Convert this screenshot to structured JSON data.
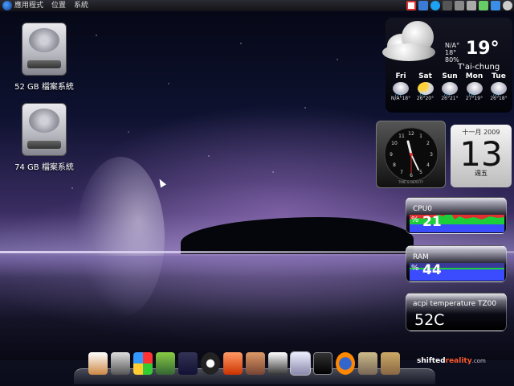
{
  "top_panel": {
    "menu": [
      "應用程式",
      "位置",
      "系統"
    ],
    "tray_icons": [
      "gmail-icon",
      "user-icon",
      "skype-icon",
      "bluetooth-icon",
      "volume-icon",
      "network-icon",
      "battery-icon",
      "update-icon",
      "power-icon"
    ]
  },
  "desktop": {
    "drives": [
      {
        "label": "52 GB 檔案系統",
        "icon": "hard-drive-icon"
      },
      {
        "label": "74 GB 檔案系統",
        "icon": "hard-drive-icon"
      }
    ]
  },
  "weather": {
    "condition": "N/A°",
    "hi": "18°",
    "humidity": "80%",
    "temperature": "19°",
    "city": "T'ai-chung",
    "forecast": [
      {
        "day": "Fri",
        "temps": "N/A°18°",
        "icon": "rain-cloud-icon"
      },
      {
        "day": "Sat",
        "temps": "26°20°",
        "icon": "sun-cloud-icon"
      },
      {
        "day": "Sun",
        "temps": "26°21°",
        "icon": "rain-cloud-icon"
      },
      {
        "day": "Mon",
        "temps": "27°19°",
        "icon": "rain-cloud-icon"
      },
      {
        "day": "Tue",
        "temps": "26°18°",
        "icon": "rain-cloud-icon"
      }
    ]
  },
  "clock": {
    "brand": "TIME & BEAUTY"
  },
  "calendar": {
    "month": "十一月 2009",
    "day": "13",
    "weekday": "週五"
  },
  "cpu": {
    "title": "CPU0",
    "percent_sign": "%",
    "value": "21",
    "level": 0.21
  },
  "ram": {
    "title": "RAM",
    "percent_sign": "%",
    "value": "44",
    "level": 0.44
  },
  "temperature": {
    "title": "acpi temperature TZ00",
    "value": "52C"
  },
  "dock": {
    "icons": [
      "home-icon",
      "optical-drive-icon",
      "windows-icon",
      "image-viewer-icon",
      "settings-sliders-icon",
      "power-icon",
      "game-icon",
      "archive-icon",
      "linux-icon",
      "documents-icon",
      "terminal-icon",
      "firefox-icon",
      "gimp-icon",
      "checklist-icon"
    ],
    "active_index": 9,
    "brand_part1": "shifted",
    "brand_part2": "reality",
    "brand_part3": ".com"
  },
  "colors": {
    "accent_red": "#e03030",
    "graph_green": "#1ccf3a",
    "graph_blue": "#3b4cff"
  }
}
